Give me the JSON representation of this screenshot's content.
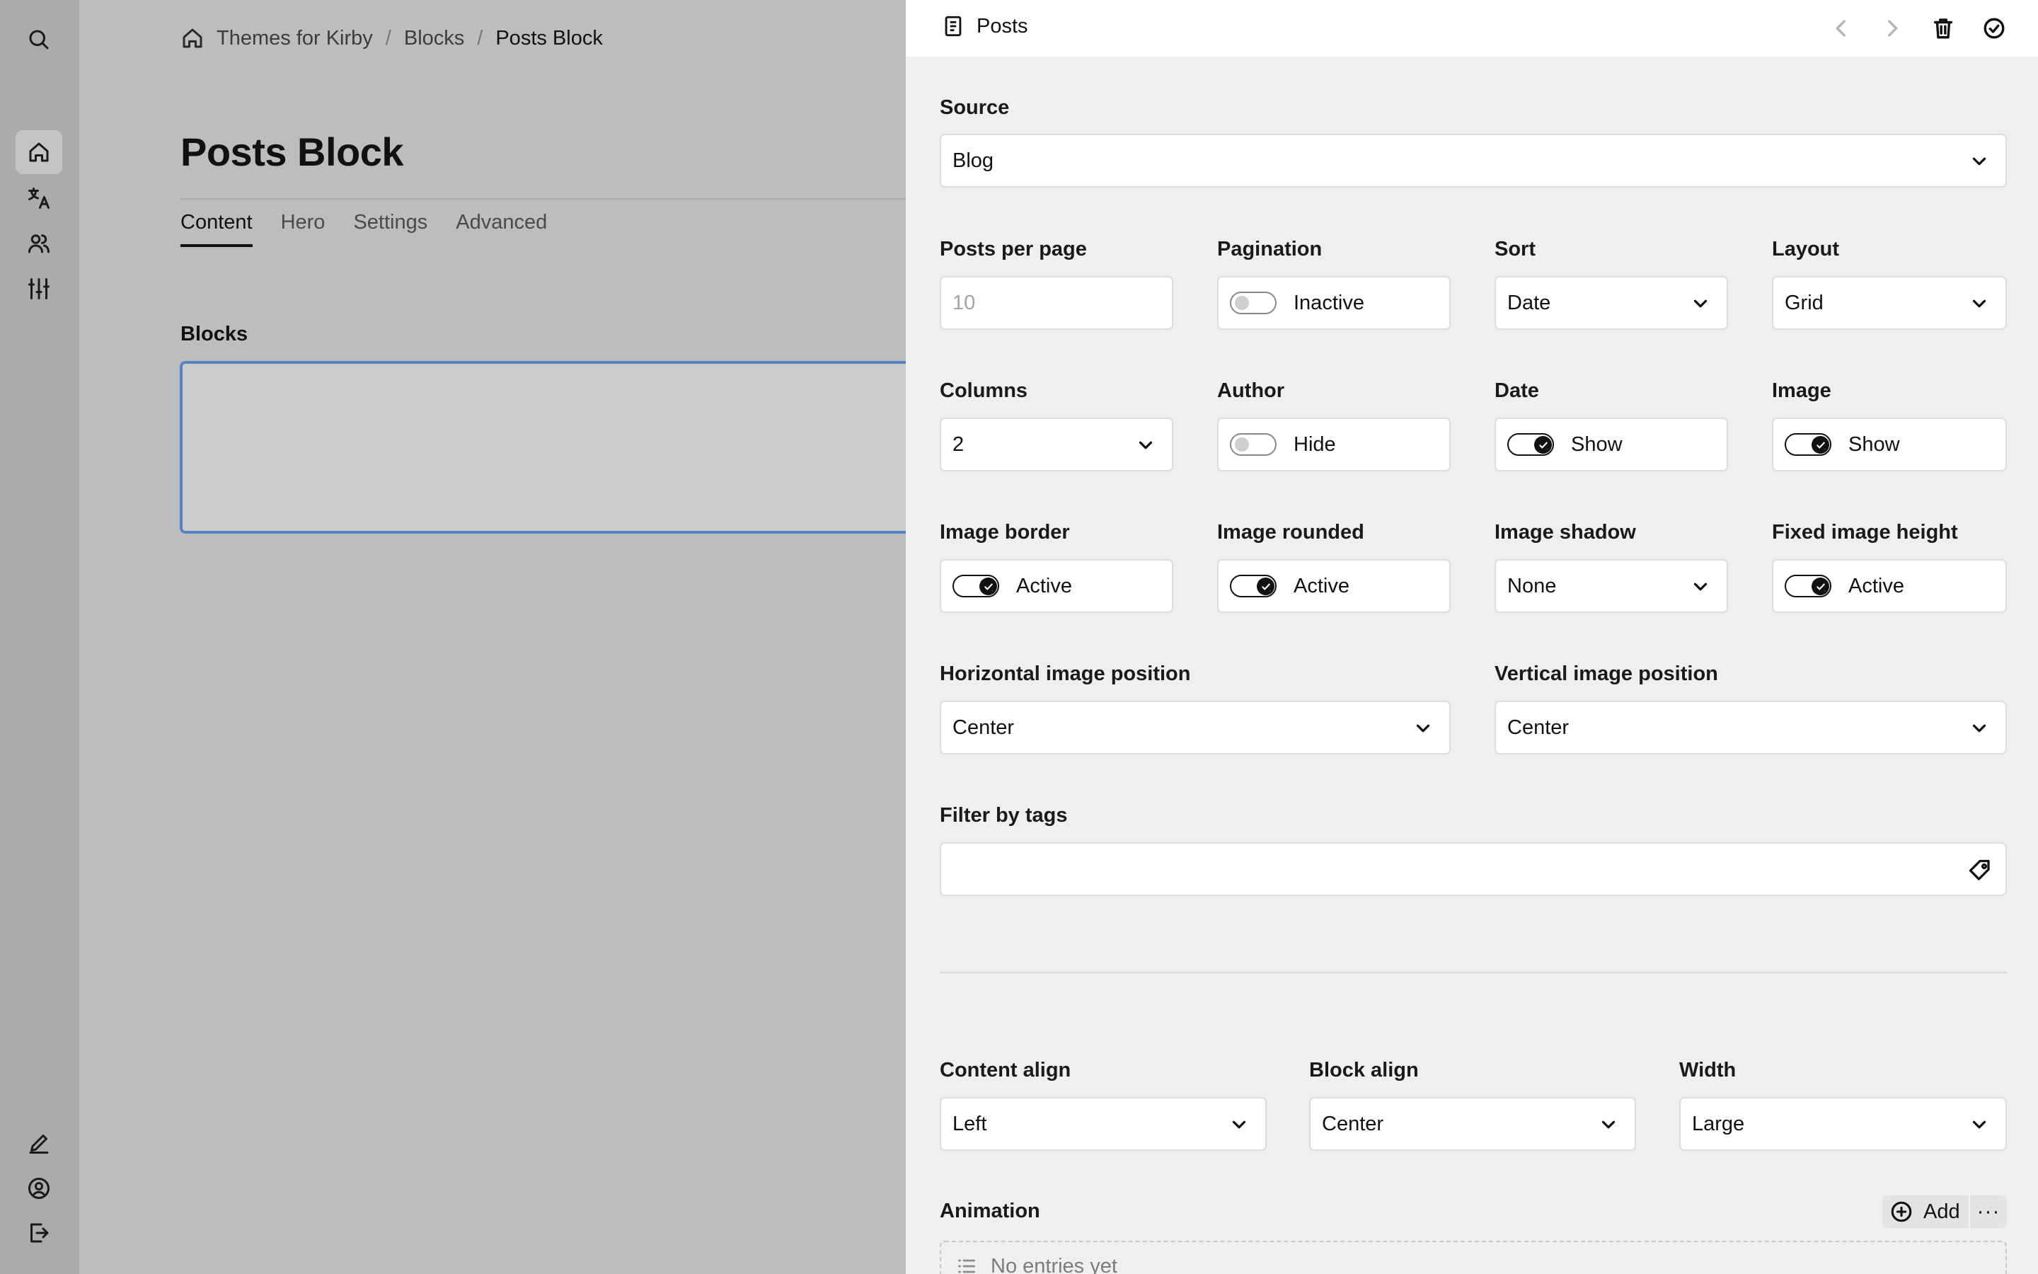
{
  "menu": {
    "items": [
      {
        "icon": "search-icon"
      },
      {
        "icon": "home-icon"
      },
      {
        "icon": "translate-icon"
      },
      {
        "icon": "users-icon"
      },
      {
        "icon": "settings-sliders-icon"
      },
      {
        "icon": "edit-icon"
      },
      {
        "icon": "account-icon"
      },
      {
        "icon": "logout-icon"
      }
    ]
  },
  "breadcrumb": {
    "items": [
      "Themes for Kirby",
      "Blocks",
      "Posts Block"
    ],
    "separator": "/"
  },
  "page": {
    "title": "Posts Block",
    "tabs": [
      "Content",
      "Hero",
      "Settings",
      "Advanced"
    ],
    "active_tab": "Content",
    "blocks_label": "Blocks"
  },
  "drawer": {
    "title": "Posts",
    "fields": {
      "source": {
        "label": "Source",
        "value": "Blog"
      },
      "posts_per_page": {
        "label": "Posts per page",
        "placeholder": "10"
      },
      "pagination": {
        "label": "Pagination",
        "value": "Inactive",
        "on": false
      },
      "sort": {
        "label": "Sort",
        "value": "Date"
      },
      "layout": {
        "label": "Layout",
        "value": "Grid"
      },
      "columns": {
        "label": "Columns",
        "value": "2"
      },
      "author": {
        "label": "Author",
        "value": "Hide",
        "on": false
      },
      "date": {
        "label": "Date",
        "value": "Show",
        "on": true
      },
      "image": {
        "label": "Image",
        "value": "Show",
        "on": true
      },
      "image_border": {
        "label": "Image border",
        "value": "Active",
        "on": true
      },
      "image_rounded": {
        "label": "Image rounded",
        "value": "Active",
        "on": true
      },
      "image_shadow": {
        "label": "Image shadow",
        "value": "None"
      },
      "fixed_image_height": {
        "label": "Fixed image height",
        "value": "Active",
        "on": true
      },
      "horizontal_image_position": {
        "label": "Horizontal image position",
        "value": "Center"
      },
      "vertical_image_position": {
        "label": "Vertical image position",
        "value": "Center"
      },
      "filter_by_tags": {
        "label": "Filter by tags",
        "value": ""
      },
      "content_align": {
        "label": "Content align",
        "value": "Left"
      },
      "block_align": {
        "label": "Block align",
        "value": "Center"
      },
      "width": {
        "label": "Width",
        "value": "Large"
      },
      "animation": {
        "label": "Animation",
        "add_label": "Add",
        "more_label": "···",
        "empty_text": "No entries yet"
      }
    }
  },
  "colors": {
    "focus_border": "#5b82c0",
    "drawer_bg": "#efefef",
    "overlay_bg": "#bdbdbd"
  }
}
